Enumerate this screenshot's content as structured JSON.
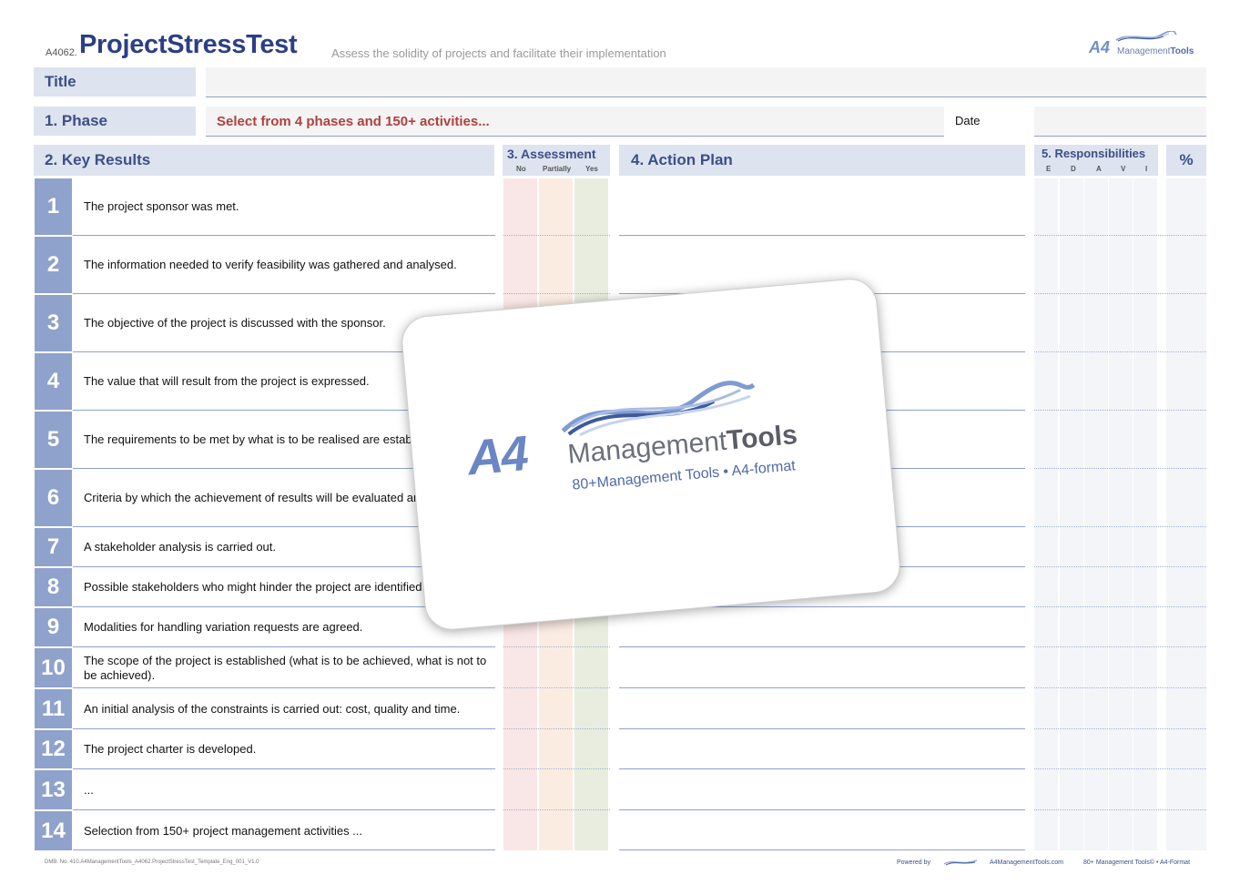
{
  "header": {
    "code": "A4062.",
    "title": "ProjectStressTest",
    "subtitle": "Assess the solidity of projects and facilitate their implementation",
    "logo_a4": "A4",
    "logo_management": "Management",
    "logo_tools": "Tools"
  },
  "fields": {
    "title_label": "Title",
    "phase_label": "1. Phase",
    "phase_value": "Select from 4 phases and 150+ activities...",
    "date_label": "Date"
  },
  "columns": {
    "key_results": "2. Key Results",
    "assessment": "3. Assessment",
    "assessment_no": "No",
    "assessment_partially": "Partially",
    "assessment_yes": "Yes",
    "action_plan": "4. Action Plan",
    "responsibilities": "5. Responsibilities",
    "resp_e": "E",
    "resp_d": "D",
    "resp_a": "A",
    "resp_v": "V",
    "resp_i": "I",
    "percent": "%"
  },
  "rows": [
    {
      "num": "1",
      "text": "The project sponsor was met."
    },
    {
      "num": "2",
      "text": "The information needed to verify feasibility was gathered and analysed."
    },
    {
      "num": "3",
      "text": "The objective of the project is discussed with the sponsor."
    },
    {
      "num": "4",
      "text": "The value that will result from the project is expressed."
    },
    {
      "num": "5",
      "text": "The requirements to be met by what is to be realised are establi sponsor."
    },
    {
      "num": "6",
      "text": "Criteria by which the achievement of results will be evaluated ar upon."
    },
    {
      "num": "7",
      "text": "A stakeholder analysis is carried out."
    },
    {
      "num": "8",
      "text": "Possible stakeholders who might hinder the project are identified"
    },
    {
      "num": "9",
      "text": "Modalities for handling variation requests are agreed."
    },
    {
      "num": "10",
      "text": "The scope of the project is established (what is to be achieved, what is not to be achieved)."
    },
    {
      "num": "11",
      "text": "An initial analysis of the constraints is carried out: cost, quality and time."
    },
    {
      "num": "12",
      "text": "The project charter is developed."
    },
    {
      "num": "13",
      "text": "..."
    },
    {
      "num": "14",
      "text": "Selection from 150+ project management activities ..."
    }
  ],
  "overlay": {
    "a4": "A4",
    "management": "Management",
    "tools": "Tools",
    "tagline": "80+Management Tools • A4-format"
  },
  "footer": {
    "doc_ref": "DMB. No. 410.A4ManagementTools_A4062.ProjectStressTest_Template_Eng_001_V1.0",
    "powered_by": "Powered by",
    "url": "A4ManagementTools.com",
    "tagline": "80+ Management Tools© • A4-Format"
  },
  "colors": {
    "accent": "#2b3f86",
    "label_bg": "#dde3ef",
    "number_bg": "#8fa2cc",
    "phase_text": "#b0413e",
    "assess_no": "#f9e6e6",
    "assess_partially": "#fbece2",
    "assess_yes": "#e8eddf"
  }
}
